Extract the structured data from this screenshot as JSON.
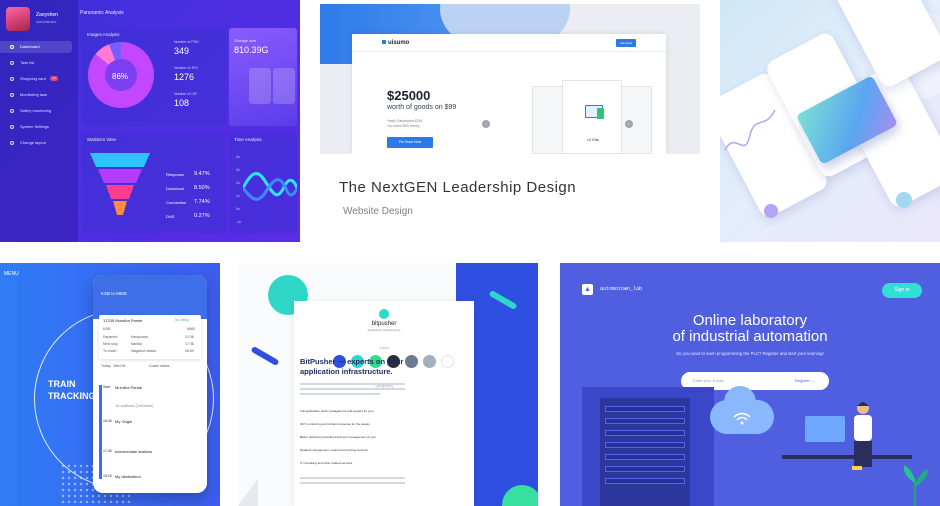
{
  "dashboard": {
    "user_name": "Zaeyshen",
    "user_role": "Administrator",
    "page_title": "Panoramic Analysis",
    "nav": [
      "Dashboard",
      "Task list",
      "Shopping card",
      "Monitoring task",
      "Safety monitoring",
      "System Settings",
      "Change layout"
    ],
    "shopping_badge": "10",
    "images_title": "Images Analysis",
    "donut_pct": "86%",
    "donut_value": 0.86,
    "stats": [
      {
        "label": "Number of PNG",
        "value": "349"
      },
      {
        "label": "Number of JPG",
        "value": "1276"
      },
      {
        "label": "Number of GIF",
        "value": "108"
      }
    ],
    "storage_label": "Storage size",
    "storage_value": "810.39G",
    "stats_view_title": "Statistics View",
    "funnel": [
      {
        "label": "Response",
        "value": "9.47%"
      },
      {
        "label": "Download",
        "value": "8.50%"
      },
      {
        "label": "Connection",
        "value": "7.74%"
      },
      {
        "label": "DNS",
        "value": "0.27%"
      }
    ],
    "time_title": "Time Analysis",
    "time_axis": [
      "4s",
      "3s",
      "2s",
      "1s",
      "0s",
      "-1s"
    ],
    "colors": {
      "accent": "#5b2ce6",
      "funnel_top": "#2ec3ff",
      "funnel_mid": "#b43cff",
      "funnel_low": "#ff3c8e",
      "funnel_base": "#ff8c3c"
    }
  },
  "website": {
    "logo": "uisumo",
    "join": "Join Now",
    "price": "$25000",
    "goods": "worth of goods on $99",
    "sub1": "Yearly Subscription $249,",
    "sub2": "You saves 95% money.",
    "cta": "Pre Book Now",
    "uikit_label": "UI Kits",
    "title": "The NextGEN Leadership Design",
    "category": "Website Design",
    "colors": {
      "accent": "#2c7be5"
    }
  },
  "mobile": {
    "colors": {
      "card_start": "#7ce0d4",
      "card_mid": "#5aa5f0",
      "card_end": "#a98df0"
    }
  },
  "train": {
    "menu": "MENU",
    "headline_1": "TRAIN",
    "headline_2": "TRACKING",
    "phone_title": "KSB to MMS",
    "train_no": "17235",
    "train_name": "Mundha Pande",
    "status": "No delay",
    "from_code": "KSB",
    "to_code": "MMS",
    "info_rows": [
      {
        "label": "Departed",
        "station": "Kasipuram",
        "time": "12:36"
      },
      {
        "label": "Next stop",
        "station": "Nanital",
        "time": "17:36"
      },
      {
        "label": "To reach",
        "station": "Nagarkot station",
        "time": "08:50"
      }
    ],
    "tab_today": "Today - Wed 06",
    "tab_coach": "Coach status",
    "stops": [
      {
        "time": "Start",
        "name": "Mundha Pande"
      },
      {
        "time": "",
        "name": "16 stations (1h54min)"
      },
      {
        "time": "16:36",
        "name": "My Origin"
      },
      {
        "time": "17:36",
        "name": "Intermediate stations"
      },
      {
        "time": "18:15",
        "name": "My destination"
      }
    ],
    "colors": {
      "bg": "#2f7cf6",
      "header": "#3f6fe8"
    }
  },
  "bitpusher": {
    "brand": "bitpusher",
    "tagline": "Application infrastructure",
    "colors_section": "Colors",
    "typo_section": "Typography",
    "swatches": [
      "#2f4fe0",
      "#2fd7c8",
      "#36d98a",
      "#2a2f3a",
      "#6b7a90",
      "#a3b0c0",
      "#ffffff"
    ],
    "headline_1": "BitPusher — experts on your",
    "headline_2": "application infrastructure.",
    "checks": [
      "Full application stack management and support for your",
      "24/7 monitoring and incident response for the assets",
      "Better deliveries provided training in management of your",
      "Needed management, support and pricing services",
      "IT consulting and other related services"
    ]
  },
  "automation": {
    "brand": "automotown_lab",
    "signin": "Sign in",
    "headline_1": "Online laboratory",
    "headline_2": "of industrial automation",
    "subtitle": "Do you want to learn programming the PLC? Register and start your learning!",
    "email_placeholder": "Enter your e-mail",
    "register": "Register",
    "colors": {
      "bg": "#4f5fe0",
      "signin": "#30e0d6"
    }
  }
}
